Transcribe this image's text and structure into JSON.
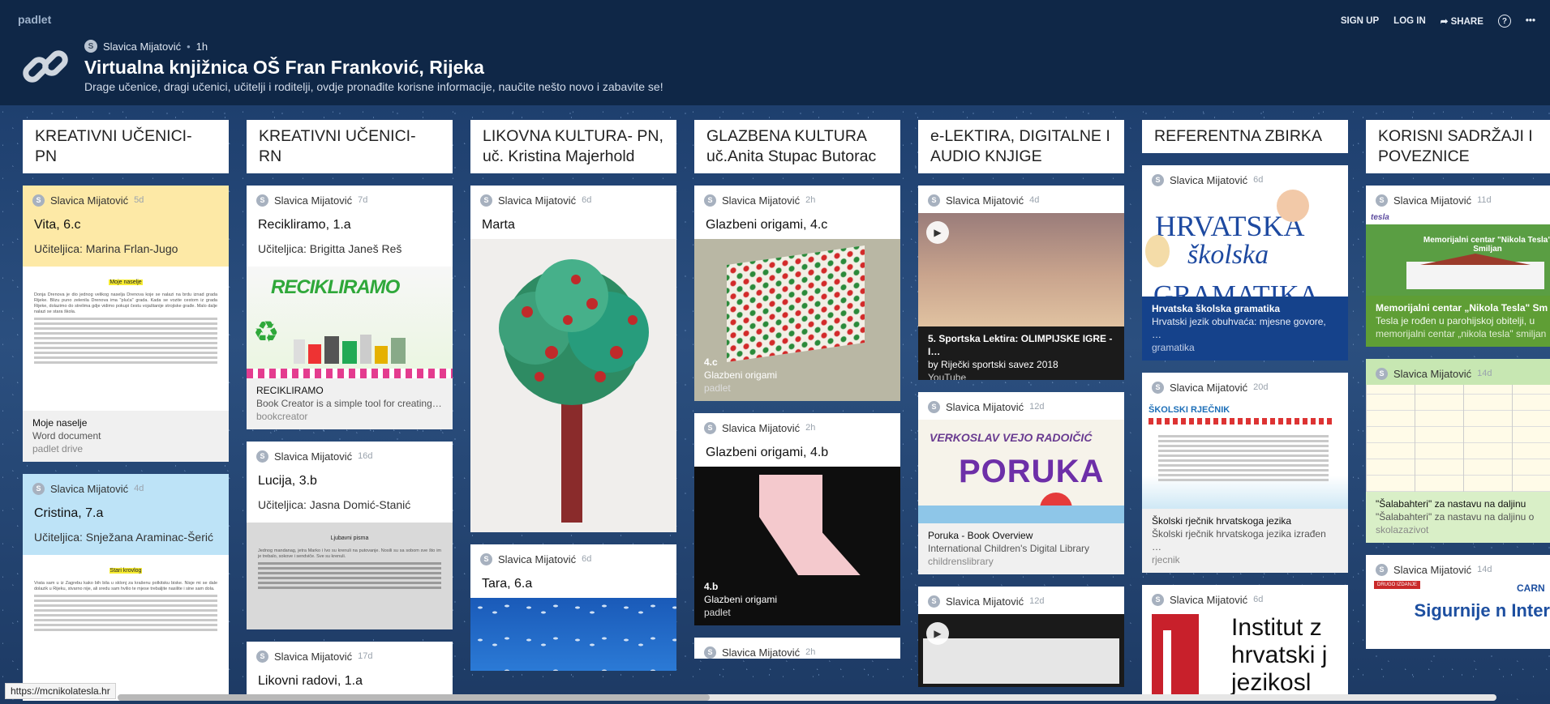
{
  "header": {
    "brand": "padlet",
    "author": "Slavica Mijatović",
    "avatar_letter": "S",
    "time": "1h",
    "title": "Virtualna knjižnica OŠ Fran Franković, Rijeka",
    "subtitle": "Drage učenice, dragi učenici, učitelji i roditelji, ovdje pronađite korisne informacije, naučite nešto novo i zabavite se!",
    "nav": {
      "signup": "SIGN UP",
      "login": "LOG IN",
      "share": "SHARE",
      "help": "?",
      "more": "•••"
    }
  },
  "columns": [
    {
      "title": "KREATIVNI UČENICI- PN",
      "cards": [
        {
          "author": "Slavica Mijatović",
          "time": "5d",
          "title": "Vita, 6.c",
          "body": "Učiteljica: Marina Frlan-Jugo",
          "doc_heading": "Moje naselje",
          "doc_text": "Donja Drenova je dio jednog velikog naselja Drenova koje se nalazi na brdu iznad grada Rijeke. Blizu puno zelenila Drenova ima \"pluća\" grada. Kada se vozite cestom iz grada Rijeke, dolazimo do strelima gdje vidimo pokupi čestu vojaštanije strojiske građe. Malo dalje nalazi se stara škola.",
          "att_title": "Moje naselje",
          "att_sub": "Word document",
          "att_src": "padlet drive"
        },
        {
          "author": "Slavica Mijatović",
          "time": "4d",
          "title": "Cristina, 7.a",
          "body": "Učiteljica: Snježana Araminac-Šerić",
          "doc_heading": "Stari krovlog",
          "doc_text": "Vrata sam u iz Zagrebu kako bih bila u sklonj za krašenu polkitsku biske. Nisje mi se dale dolazik u Rijeku, stvarno nije, ali sredu sam hvilio te mjese trebaljite nasilite i sine sam dola."
        }
      ]
    },
    {
      "title": "KREATIVNI UČENICI- RN",
      "cards": [
        {
          "author": "Slavica Mijatović",
          "time": "7d",
          "title": "Recikliramo, 1.a",
          "body": "Učiteljica: Brigitta Janeš Reš",
          "image_text": "RECIKLIRAMO",
          "att_title": "RECIKLIRAMO",
          "att_sub": "Book Creator is a simple tool for creating…",
          "att_src": "bookcreator"
        },
        {
          "author": "Slavica Mijatović",
          "time": "16d",
          "title": "Lucija, 3.b",
          "body": "Učiteljica: Jasna Domić-Stanić",
          "doc_heading": "Ljubavni pisma",
          "doc_text": "Jednog mandanag, jetra Marko i Ivo su krenuli na putovanje. Nosili su sa sobom sve što im je trebalo, sokove i sendviče. Sve su krenuli."
        },
        {
          "author": "Slavica Mijatović",
          "time": "17d",
          "title": "Likovni radovi, 1.a"
        }
      ]
    },
    {
      "title": "LIKOVNA KULTURA- PN, uč. Kristina Majerhold",
      "cards": [
        {
          "author": "Slavica Mijatović",
          "time": "6d",
          "title": "Marta"
        },
        {
          "author": "Slavica Mijatović",
          "time": "6d",
          "title": "Tara, 6.a"
        }
      ]
    },
    {
      "title": "GLAZBENA KULTURA uč.Anita Stupac Butorac",
      "cards": [
        {
          "author": "Slavica Mijatović",
          "time": "2h",
          "title": "Glazbeni origami, 4.c",
          "att_title": "4.c",
          "att_sub": "Glazbeni origami",
          "att_src": "padlet"
        },
        {
          "author": "Slavica Mijatović",
          "time": "2h",
          "title": "Glazbeni origami, 4.b",
          "att_title": "4.b",
          "att_sub": "Glazbeni origami",
          "att_src": "padlet"
        },
        {
          "author": "Slavica Mijatović",
          "time": "2h"
        }
      ]
    },
    {
      "title": "e-LEKTIRA, DIGITALNE I AUDIO KNJIGE",
      "cards": [
        {
          "author": "Slavica Mijatović",
          "time": "4d",
          "att_title": "5. Sportska Lektira: OLIMPIJSKE IGRE - I…",
          "att_sub": "by Riječki sportski savez 2018",
          "att_src": "YouTube"
        },
        {
          "author": "Slavica Mijatović",
          "time": "12d",
          "image_text_top": "VERKOSLAV VEJO RADOIČIĆ",
          "image_text": "PORUKA",
          "att_title": "Poruka - Book Overview",
          "att_sub": "International Children's Digital Library",
          "att_src": "childrenslibrary"
        },
        {
          "author": "Slavica Mijatović",
          "time": "12d"
        }
      ]
    },
    {
      "title": "REFERENTNA ZBIRKA",
      "cards": [
        {
          "author": "Slavica Mijatović",
          "time": "6d",
          "image_text1": "HRVATSKA",
          "image_text2": "školska",
          "image_text3": "GRAMATIKA",
          "att_title": "Hrvatska školska gramatika",
          "att_sub": "Hrvatski jezik obuhvaća: mjesne govore, …",
          "att_src": "gramatika"
        },
        {
          "author": "Slavica Mijatović",
          "time": "20d",
          "image_text": "ŠKOLSKI RJEČNIK",
          "att_title": "Školski rječnik hrvatskoga jezika",
          "att_sub": "Školski rječnik hrvatskoga jezika izrađen …",
          "att_src": "rjecnik"
        },
        {
          "author": "Slavica Mijatović",
          "time": "6d",
          "image_text": "Institut z hrvatski j jezikosl"
        }
      ]
    },
    {
      "title": "KORISNI SADRŽAJI I POVEZNICE",
      "cards": [
        {
          "author": "Slavica Mijatović",
          "time": "11d",
          "image_logo": "tesla",
          "image_text": "Memorijalni centar \"Nikola Tesla\" Smiljan",
          "att_title": "Memorijalni centar „Nikola Tesla\" Sm",
          "att_sub": "Tesla je rođen u parohijskoj obitelji, u",
          "att_src": "memorijalni centar „nikola tesla\" smiljan"
        },
        {
          "author": "Slavica Mijatović",
          "time": "14d",
          "att_title": "\"Šalabahteri\" za nastavu na daljinu",
          "att_sub": "\"Šalabahteri\" za nastavu na daljinu o",
          "att_src": "skolazazivot"
        },
        {
          "author": "Slavica Mijatović",
          "time": "14d",
          "image_badge": "DRUGO IZDANJE",
          "image_logo": "CARN",
          "image_text": "Sigurnije n Internet"
        }
      ]
    }
  ],
  "statusbar": {
    "url": "https://mcnikolatesla.hr"
  },
  "colors": {
    "header_bg": "#0f2747",
    "yellow_card": "#fde9a6",
    "blue_card": "#bde3f7",
    "green_card": "#c7e7b2",
    "gramatika_bar": "#15428b"
  }
}
